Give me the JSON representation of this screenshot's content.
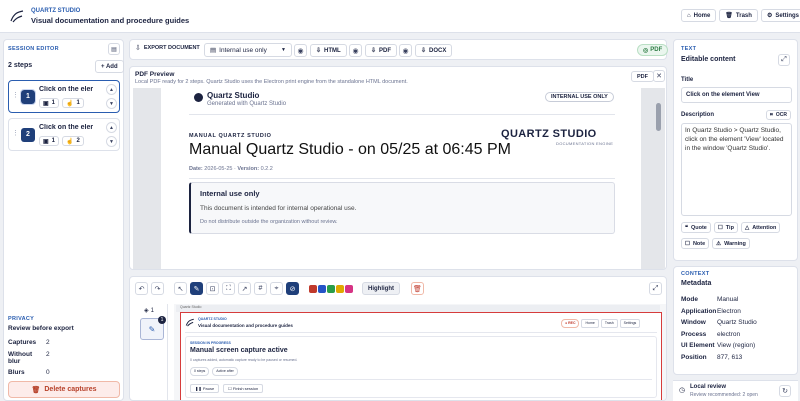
{
  "header": {
    "brand": "QUARTZ STUDIO",
    "subtitle": "Visual documentation and procedure guides",
    "home": "Home",
    "trash": "Trash",
    "settings": "Settings"
  },
  "session": {
    "label": "SESSION EDITOR",
    "steps_count": "2 steps",
    "add": "+ Add",
    "steps": [
      {
        "num": "1",
        "title": "Click on the eler",
        "captures": "1",
        "badge": "1"
      },
      {
        "num": "2",
        "title": "Click on the eler",
        "captures": "1",
        "badge": "2"
      }
    ]
  },
  "privacy": {
    "label": "PRIVACY",
    "title": "Review before export",
    "rows": [
      {
        "k": "Captures",
        "v": "2"
      },
      {
        "k": "Without blur",
        "v": "2"
      },
      {
        "k": "Blurs",
        "v": "0"
      }
    ],
    "delete": "Delete captures"
  },
  "toolbar": {
    "export": "EXPORT DOCUMENT",
    "visibility": "Internal use only",
    "html": "HTML",
    "pdf": "PDF",
    "docx": "DOCX",
    "pdf_badge": "PDF"
  },
  "preview": {
    "title": "PDF Preview",
    "desc": "Local PDF ready for 2 steps. Quartz Studio uses the Electron print engine from the standalone HTML document.",
    "pdf_tag": "PDF",
    "doc": {
      "brand": "Quartz Studio",
      "generated": "Generated with Quartz Studio",
      "stamp": "INTERNAL USE ONLY",
      "kicker": "MANUAL QUARTZ STUDIO",
      "logo": "QUARTZ STUDIO",
      "logo_sub": "DOCUMENTATION ENGINE",
      "heading": "Manual Quartz Studio - on 05/25 at 06:45 PM",
      "date_label": "Date:",
      "date": "2026-05-25",
      "version_label": "Version:",
      "version": "0.2.2",
      "notice_title": "Internal use only",
      "notice_body": "This document is intended for internal operational use.",
      "notice_small": "Do not distribute outside the organization without review."
    }
  },
  "editor": {
    "highlight": "Highlight",
    "colors": [
      "#c0392b",
      "#2554c7",
      "#2a9d4a",
      "#e0a800",
      "#d63384"
    ],
    "thumb_count": "1",
    "thumb_badge": "1",
    "mini": {
      "brand": "QUARTZ STUDIO",
      "subtitle": "Visual documentation and procedure guides",
      "rec": "REC",
      "home": "Home",
      "trash": "Trash",
      "settings": "Settings",
      "label": "SESSION IN PROGRESS",
      "title": "Manual screen capture active",
      "desc": "0 captures added, automatic capture ready to be paused or resumed.",
      "chip1": "0 steps",
      "chip2": "Active after",
      "pause": "Pause",
      "finish": "Finish session"
    }
  },
  "text": {
    "label": "TEXT",
    "title": "Editable content",
    "title_label": "Title",
    "title_value": "Click on the element View",
    "desc_label": "Description",
    "ocr": "OCR",
    "description": "In Quartz Studio > Quartz Studio, click on the element 'View' located in the window 'Quartz Studio'.",
    "chips": [
      "Quote",
      "Tip",
      "Attention",
      "Note",
      "Warning"
    ]
  },
  "context": {
    "label": "CONTEXT",
    "title": "Metadata",
    "rows": [
      {
        "k": "Mode",
        "v": "Manual"
      },
      {
        "k": "Application",
        "v": "Electron"
      },
      {
        "k": "Window",
        "v": "Quartz Studio"
      },
      {
        "k": "Process",
        "v": "electron"
      },
      {
        "k": "UI Element",
        "v": "View (region)"
      },
      {
        "k": "Position",
        "v": "877, 613"
      }
    ]
  },
  "review": {
    "title": "Local review",
    "sub": "Review recommended: 2 open"
  }
}
